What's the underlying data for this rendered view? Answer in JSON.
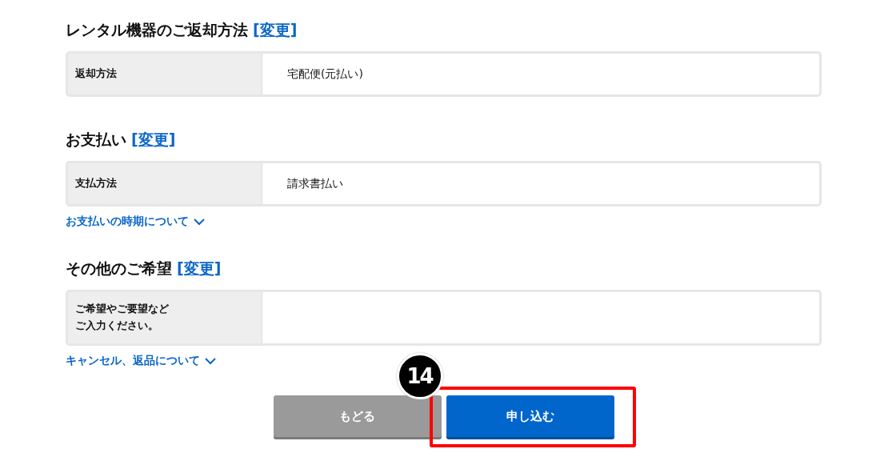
{
  "sections": [
    {
      "heading": "レンタル機器のご返却方法",
      "change_link": "[変更]",
      "field": {
        "label": "返却方法",
        "value": "宅配便(元払い)"
      }
    },
    {
      "heading": "お支払い",
      "change_link": "[変更]",
      "field": {
        "label": "支払方法",
        "value": "請求書払い"
      },
      "expander": "お支払いの時期について"
    },
    {
      "heading": "その他のご希望",
      "change_link": "[変更]",
      "field": {
        "label_lines": [
          "ご希望やご要望など",
          "ご入力ください。"
        ]
      },
      "expander": "キャンセル、返品について"
    }
  ],
  "buttons": [
    {
      "label": "もどる",
      "kind": "back"
    },
    {
      "label": "申し込む",
      "kind": "submit",
      "highlighted": true
    }
  ],
  "step_badge": "14"
}
